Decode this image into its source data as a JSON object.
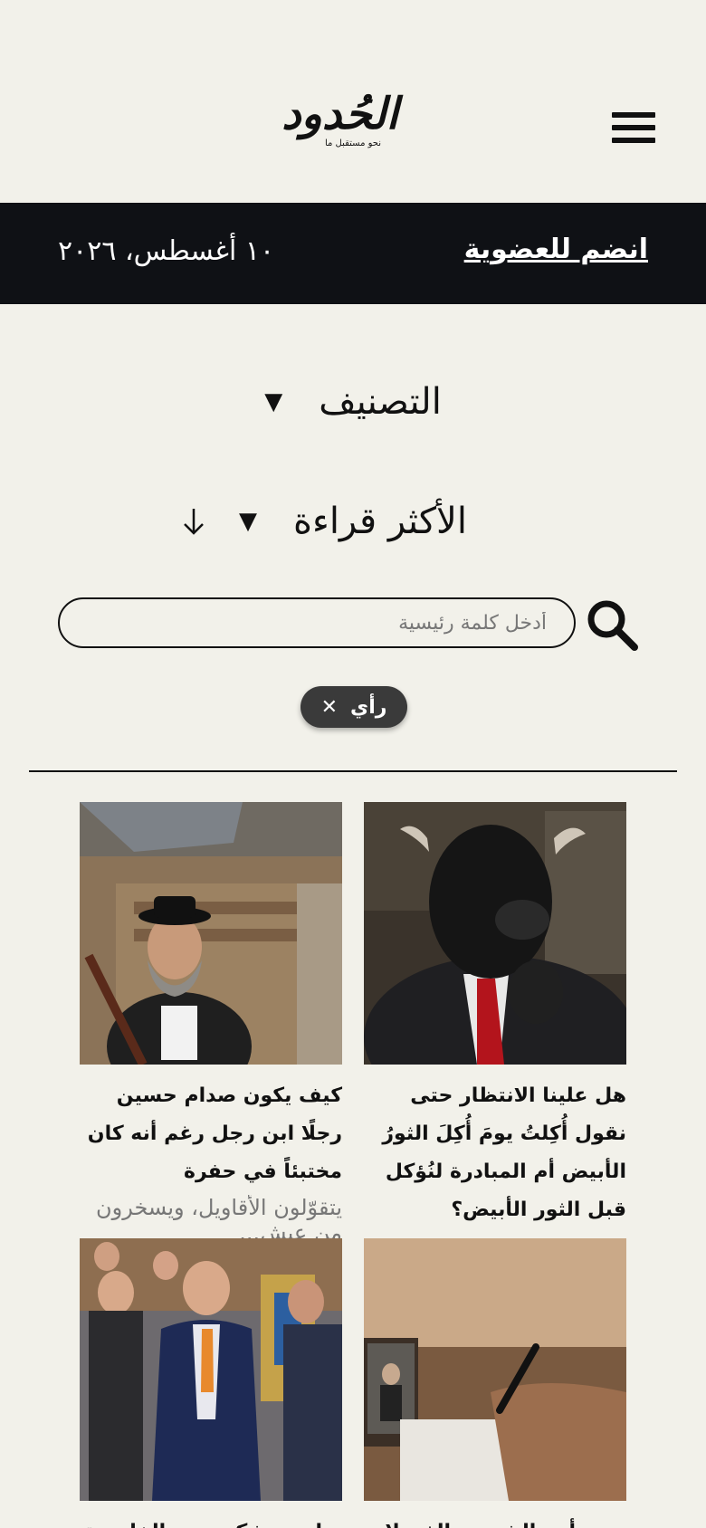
{
  "header": {
    "logo_text": "الحُدود",
    "logo_tagline": "نحو مستقبل ما",
    "menu_icon": "hamburger-menu-icon"
  },
  "topbar": {
    "join_label": "انضم للعضوية",
    "date": "١٠ أغسطس، ٢٠٢٦"
  },
  "filters": {
    "category_label": "التصنيف",
    "sort_label": "الأكثر قراءة",
    "dropdown_icon": "triangle-down-icon",
    "sort_direction_icon": "arrow-down-icon"
  },
  "search": {
    "placeholder": "أدخل كلمة رئيسية",
    "value": "",
    "icon": "search-icon"
  },
  "active_tag": {
    "label": "رأي",
    "remove_icon": "close-icon"
  },
  "articles": [
    {
      "title": "هل علينا الانتظار حتى نقول أُكِلتُ يومَ أُكِلَ الثورُ الأبيض أم المبادرة لنُؤكل قبل الثور الأبيض؟",
      "excerpt": ""
    },
    {
      "title": "كيف يكون صدام حسين رجلًا ابن رجل رغم أنه كان مختبئاً في حفرة",
      "excerpt": "يتقوّلون الأقاويل، ويسخرون من عيش..."
    },
    {
      "title": "حزن أحد الشعوب الذي لا تحبه",
      "excerpt": ""
    },
    {
      "title": "ترامب يشكر وزير الخارجية على تصفيقه",
      "excerpt": ""
    }
  ],
  "colors": {
    "background": "#f2f1ea",
    "topbar": "#0f1115",
    "chip": "#3a3a3a"
  }
}
